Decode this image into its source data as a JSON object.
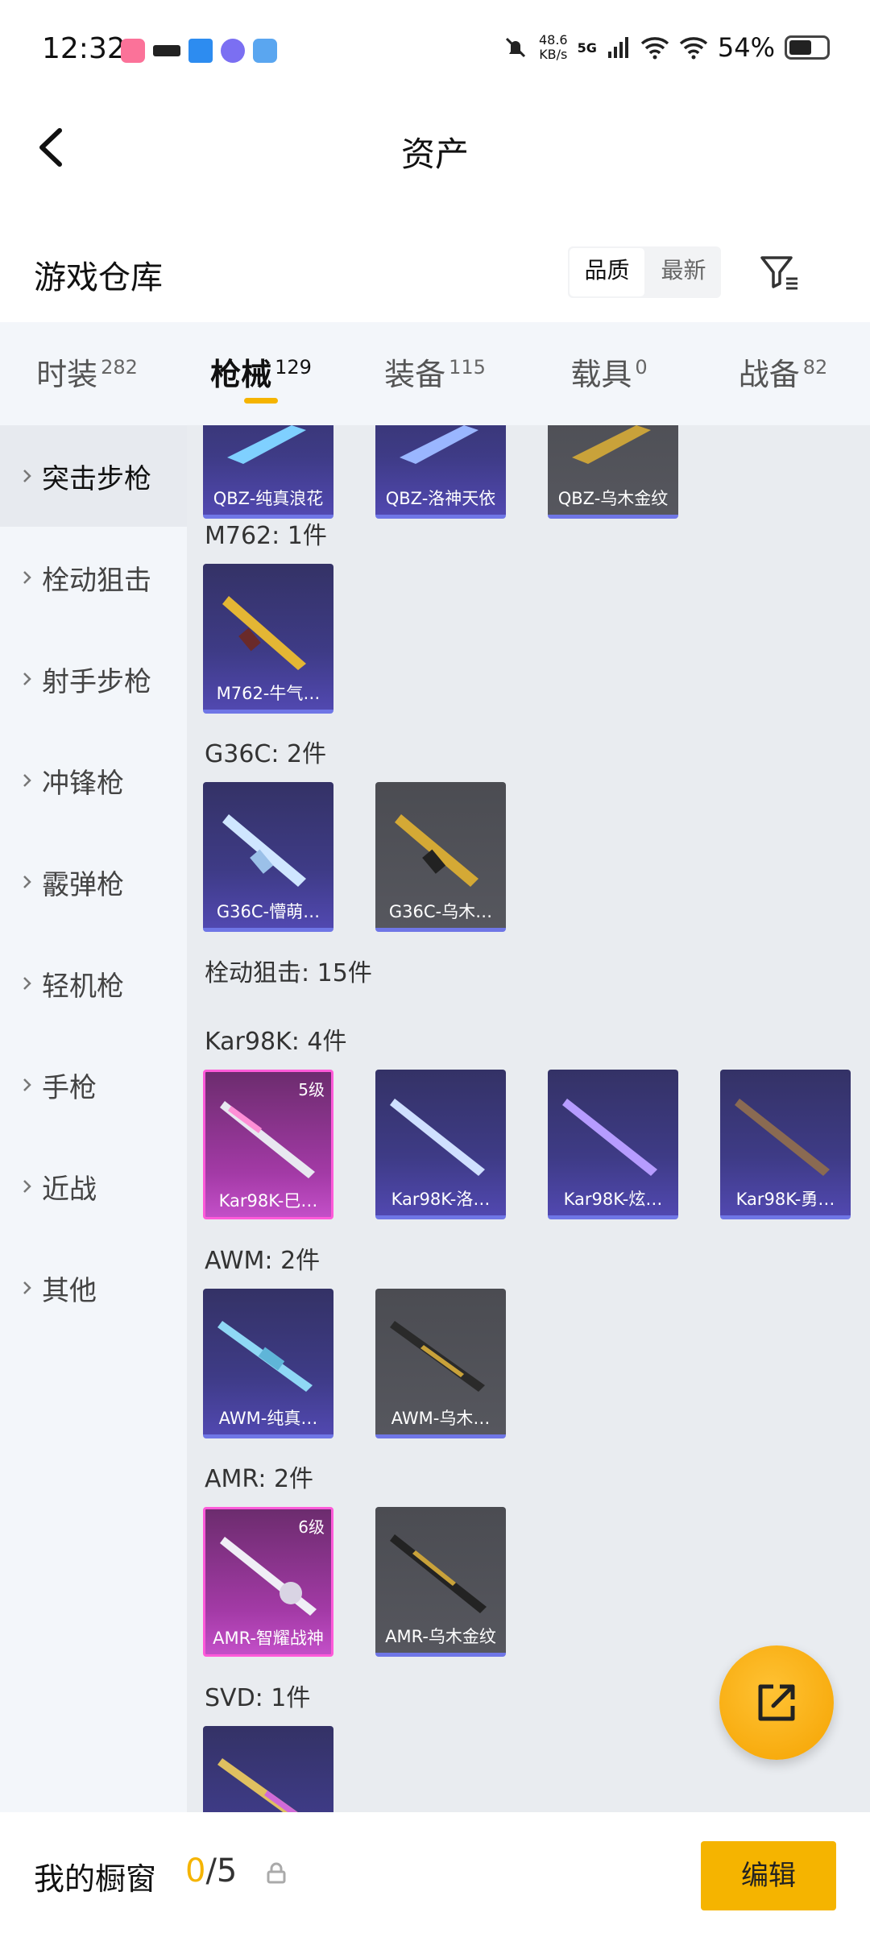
{
  "status_bar": {
    "time": "12:32",
    "net_speed_value": "48.6",
    "net_speed_unit": "KB/s",
    "network": "5G",
    "battery": "54%"
  },
  "header": {
    "title": "资产"
  },
  "warehouse": {
    "title": "游戏仓库",
    "sort_options": [
      "品质",
      "最新"
    ],
    "sort_selected": "品质"
  },
  "tabs": [
    {
      "label": "时装",
      "count": "282"
    },
    {
      "label": "枪械",
      "count": "129"
    },
    {
      "label": "装备",
      "count": "115"
    },
    {
      "label": "载具",
      "count": "0"
    },
    {
      "label": "战备",
      "count": "82"
    }
  ],
  "active_tab": "枪械",
  "categories": [
    "突击步枪",
    "栓动狙击",
    "射手步枪",
    "冲锋枪",
    "霰弹枪",
    "轻机枪",
    "手枪",
    "近战",
    "其他"
  ],
  "active_category": "突击步枪",
  "content": {
    "top_items": [
      "QBZ-纯真浪花",
      "QBZ-洛神天依",
      "QBZ-乌木金纹"
    ],
    "groups": [
      {
        "title": "M762: 1件",
        "items": [
          {
            "name": "M762-牛气…",
            "rarity": "blue"
          }
        ]
      },
      {
        "title": "G36C: 2件",
        "items": [
          {
            "name": "G36C-懵萌…",
            "rarity": "blue"
          },
          {
            "name": "G36C-乌木…",
            "rarity": "gray"
          }
        ]
      },
      {
        "title": "栓动狙击: 15件",
        "items": []
      },
      {
        "title": "Kar98K: 4件",
        "items": [
          {
            "name": "Kar98K-巳…",
            "rarity": "pink",
            "level": "5级"
          },
          {
            "name": "Kar98K-洛…",
            "rarity": "blue"
          },
          {
            "name": "Kar98K-炫…",
            "rarity": "blue"
          },
          {
            "name": "Kar98K-勇…",
            "rarity": "blue"
          }
        ]
      },
      {
        "title": "AWM: 2件",
        "items": [
          {
            "name": "AWM-纯真…",
            "rarity": "blue"
          },
          {
            "name": "AWM-乌木…",
            "rarity": "gray"
          }
        ]
      },
      {
        "title": "AMR: 2件",
        "items": [
          {
            "name": "AMR-智耀战神",
            "rarity": "pink",
            "level": "6级"
          },
          {
            "name": "AMR-乌木金纹",
            "rarity": "gray"
          }
        ]
      },
      {
        "title": "SVD: 1件",
        "items": [
          {
            "name": "",
            "rarity": "blue"
          }
        ]
      }
    ]
  },
  "bottom_bar": {
    "label": "我的橱窗",
    "current": "0",
    "total": "/5",
    "edit_label": "编辑"
  },
  "colors": {
    "accent": "#f5b400",
    "rarity_blue": "#3e3b86",
    "rarity_gray": "#56575e",
    "rarity_pink": "#a33aa6"
  },
  "icons": {
    "back": "chevron-left-icon",
    "filter": "filter-icon",
    "share": "share-external-icon",
    "lock": "lock-icon"
  }
}
